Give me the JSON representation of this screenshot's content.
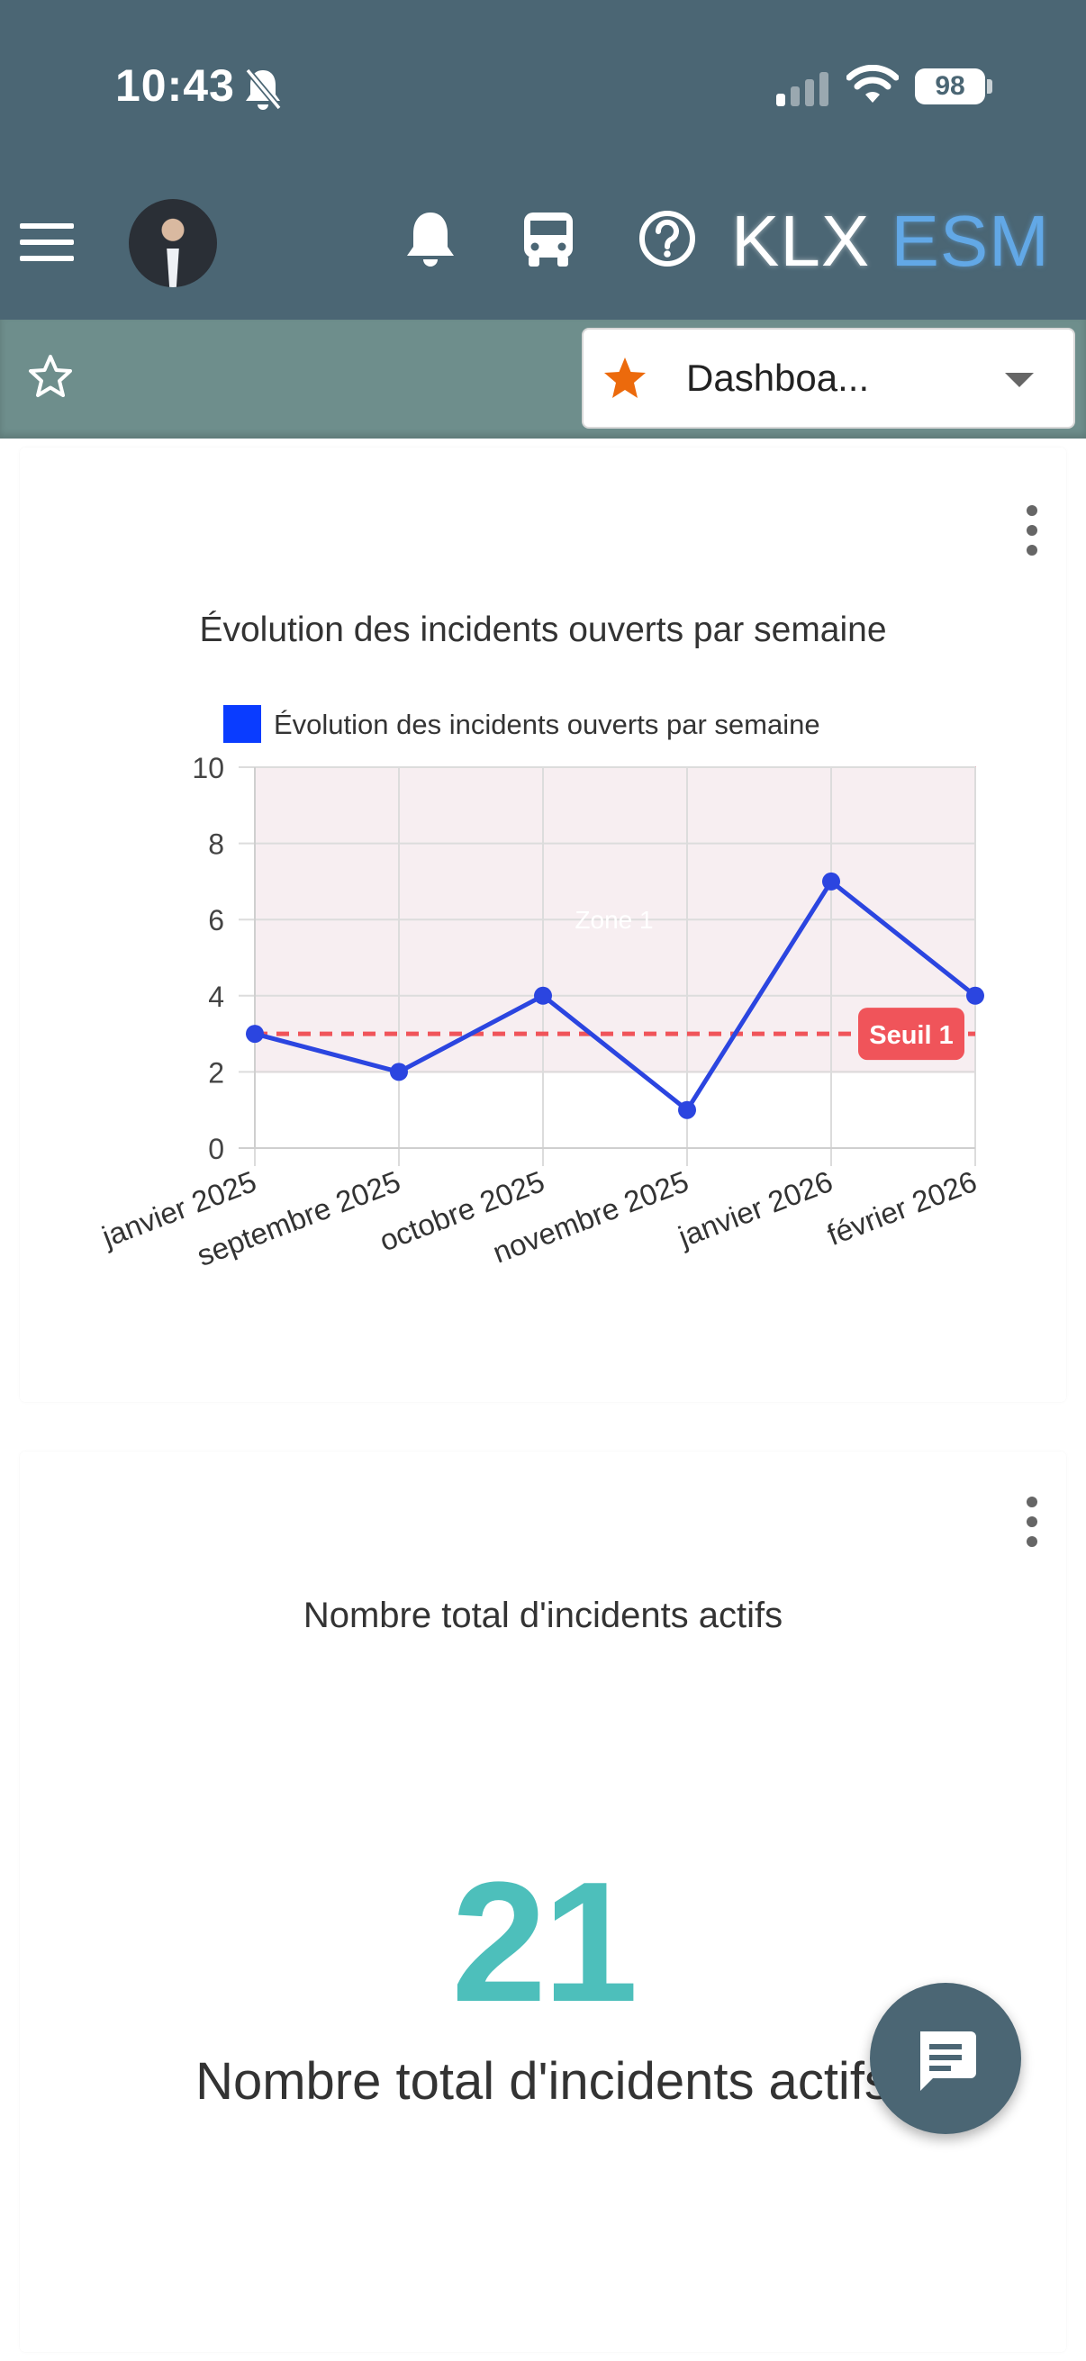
{
  "status_bar": {
    "time": "10:43",
    "battery": "98"
  },
  "header": {
    "brand_primary": "KLX",
    "brand_secondary": "ESM",
    "icons": [
      "menu-icon",
      "avatar",
      "bell-icon",
      "bus-icon",
      "help-icon"
    ]
  },
  "toolbar": {
    "dashboard_select_value": "Dashboa..."
  },
  "chart_card": {
    "title": "Évolution des incidents ouverts par semaine"
  },
  "chart_data": {
    "type": "line",
    "title": "Évolution des incidents ouverts par semaine",
    "categories": [
      "janvier 2025",
      "septembre 2025",
      "octobre 2025",
      "novembre 2025",
      "janvier 2026",
      "février 2026"
    ],
    "series": [
      {
        "name": "Évolution des incidents ouverts par semaine",
        "values": [
          3,
          2,
          4,
          1,
          7,
          4
        ],
        "color": "#2b45e0",
        "legend_color": "#0a3cff"
      }
    ],
    "ylim": [
      0,
      10
    ],
    "yticks": [
      0,
      2,
      4,
      6,
      8,
      10
    ],
    "grid": true,
    "legend": "top",
    "annotations": [
      {
        "type": "box",
        "label": "Zone 1",
        "y_from": 2,
        "y_to": 10,
        "fill": "#f7eef1",
        "stroke": "#e9b7c2"
      },
      {
        "type": "line",
        "label": "Seuil 1",
        "y": 3,
        "color": "#f0545a",
        "dashed": true
      }
    ]
  },
  "kpi_card": {
    "title": "Nombre total d'incidents actifs",
    "value": "21",
    "caption": "Nombre total d'incidents actifs",
    "value_color": "#4dbfbb"
  },
  "fab": {
    "icon": "chat-icon"
  }
}
